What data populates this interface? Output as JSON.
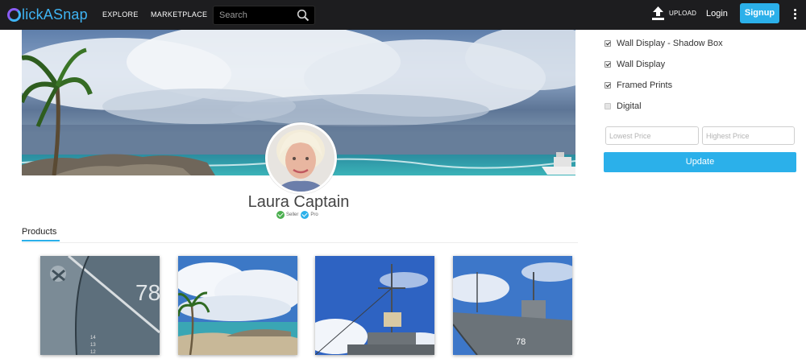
{
  "header": {
    "logo_text": "lickASnap",
    "nav": {
      "explore": "EXPLORE",
      "marketplace": "MARKETPLACE"
    },
    "search_placeholder": "Search",
    "upload_label": "UPLOAD",
    "login_label": "Login",
    "signup_label": "Signup",
    "colors": {
      "bar": "#1d1d1f",
      "accent": "#2bb0ea",
      "logo_purple": "#8a5cf5"
    }
  },
  "profile": {
    "name": "Laura Captain",
    "badges": [
      {
        "label": "Seller",
        "color": "#4caf50"
      },
      {
        "label": "Pro",
        "color": "#2bb0ea"
      }
    ]
  },
  "tabs": {
    "products": "Products"
  },
  "products": [
    {
      "subject": "ship-hull-anchor-78"
    },
    {
      "subject": "tropical-beach-clouds"
    },
    {
      "subject": "ship-mast-sky"
    },
    {
      "subject": "navy-ship-78-bow"
    }
  ],
  "filters": {
    "options": [
      {
        "label": "Wall Display - Shadow Box",
        "checked": true
      },
      {
        "label": "Wall Display",
        "checked": true
      },
      {
        "label": "Framed Prints",
        "checked": true
      },
      {
        "label": "Digital",
        "checked": false
      }
    ],
    "lowest_price_placeholder": "Lowest Price",
    "highest_price_placeholder": "Highest Price",
    "update_label": "Update"
  }
}
